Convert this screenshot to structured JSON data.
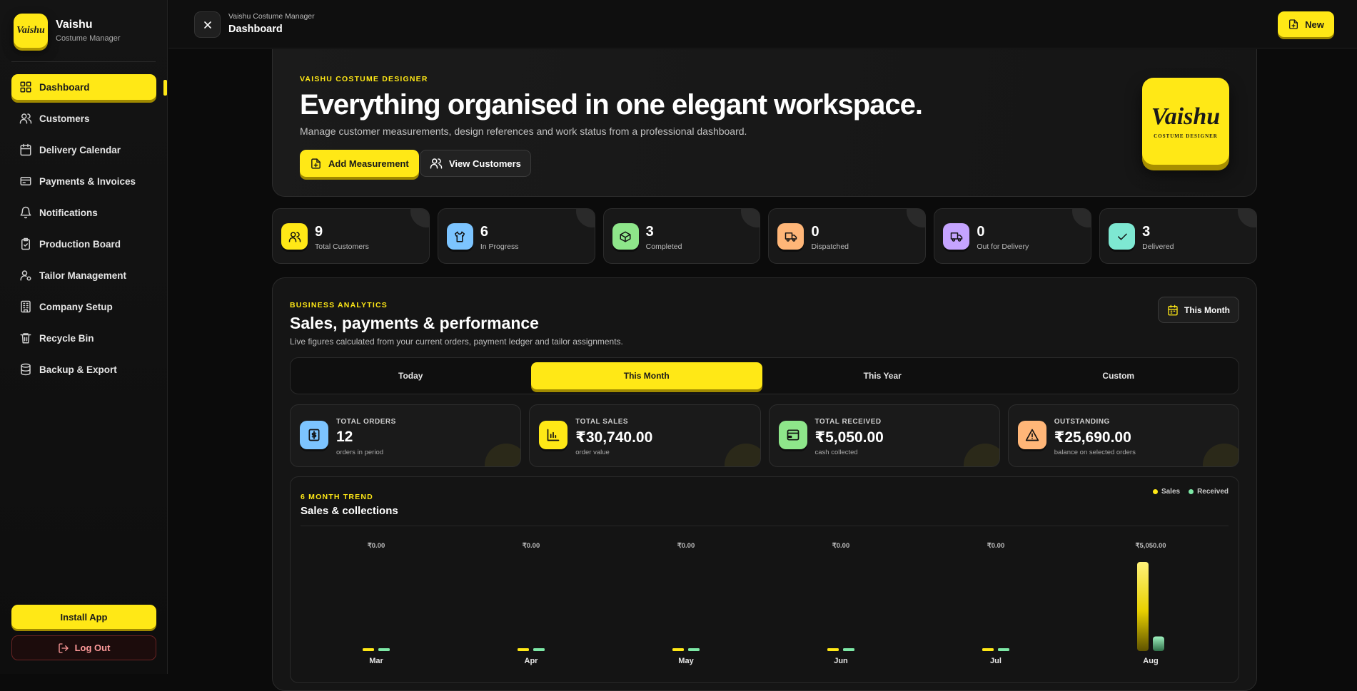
{
  "sidebar": {
    "brand_name": "Vaishu",
    "brand_sub": "Costume Manager",
    "logo_text": "Vaishu",
    "items": [
      {
        "label": "Dashboard",
        "icon": "dashboard-icon",
        "active": true
      },
      {
        "label": "Customers",
        "icon": "users-icon"
      },
      {
        "label": "Delivery Calendar",
        "icon": "calendar-icon"
      },
      {
        "label": "Payments & Invoices",
        "icon": "invoice-icon"
      },
      {
        "label": "Notifications",
        "icon": "bell-icon"
      },
      {
        "label": "Production Board",
        "icon": "clipboard-icon"
      },
      {
        "label": "Tailor Management",
        "icon": "user-gear-icon"
      },
      {
        "label": "Company Setup",
        "icon": "building-icon"
      },
      {
        "label": "Recycle Bin",
        "icon": "trash-icon"
      },
      {
        "label": "Backup & Export",
        "icon": "database-icon"
      }
    ],
    "install_label": "Install App",
    "logout_label": "Log Out"
  },
  "topbar": {
    "crumb": "Vaishu Costume Manager",
    "title": "Dashboard",
    "new_label": "New"
  },
  "hero": {
    "eyebrow": "VAISHU COSTUME DESIGNER",
    "title": "Everything organised in one elegant workspace.",
    "subtitle": "Manage customer measurements, design references and work status from a professional dashboard.",
    "add_label": "Add Measurement",
    "view_label": "View Customers",
    "logo_main": "Vaishu",
    "logo_sub": "COSTUME DESIGNER"
  },
  "stats": [
    {
      "value": "9",
      "label": "Total Customers",
      "color": "#ffe816",
      "icon": "users-icon"
    },
    {
      "value": "6",
      "label": "In Progress",
      "color": "#7cc4ff",
      "icon": "shirt-icon"
    },
    {
      "value": "3",
      "label": "Completed",
      "color": "#8ee68a",
      "icon": "box-icon"
    },
    {
      "value": "0",
      "label": "Dispatched",
      "color": "#ffb678",
      "icon": "truck-icon"
    },
    {
      "value": "0",
      "label": "Out for Delivery",
      "color": "#c5a4ff",
      "icon": "truck-icon"
    },
    {
      "value": "3",
      "label": "Delivered",
      "color": "#7ee8d2",
      "icon": "check-icon"
    }
  ],
  "analytics": {
    "eyebrow": "BUSINESS ANALYTICS",
    "title": "Sales, payments & performance",
    "subtitle": "Live figures calculated from your current orders, payment ledger and tailor assignments.",
    "period_label": "This Month",
    "tabs": [
      {
        "label": "Today"
      },
      {
        "label": "This Month",
        "active": true
      },
      {
        "label": "This Year"
      },
      {
        "label": "Custom"
      }
    ],
    "kpis": [
      {
        "label": "TOTAL ORDERS",
        "value": "12",
        "note": "orders in period",
        "color": "#7cc4ff",
        "icon": "receipt-icon"
      },
      {
        "label": "TOTAL SALES",
        "value": "₹30,740.00",
        "note": "order value",
        "color": "#ffe816",
        "icon": "bar-chart-icon"
      },
      {
        "label": "TOTAL RECEIVED",
        "value": "₹5,050.00",
        "note": "cash collected",
        "color": "#8ee68a",
        "icon": "wallet-icon"
      },
      {
        "label": "OUTSTANDING",
        "value": "₹25,690.00",
        "note": "balance on selected orders",
        "color": "#ffb678",
        "icon": "alert-icon"
      }
    ],
    "trend": {
      "eyebrow": "6 MONTH TREND",
      "title": "Sales & collections",
      "legend_sales": "Sales",
      "legend_received": "Received",
      "sales_color": "#ffe816",
      "received_color": "#7de8a6"
    }
  },
  "chart_data": {
    "type": "bar",
    "categories": [
      "Mar",
      "Apr",
      "May",
      "Jun",
      "Jul",
      "Aug"
    ],
    "series": [
      {
        "name": "Sales",
        "values": [
          0,
          0,
          0,
          0,
          0,
          30740
        ]
      },
      {
        "name": "Received",
        "values": [
          0,
          0,
          0,
          0,
          0,
          5050
        ]
      }
    ],
    "top_labels": [
      "₹0.00",
      "₹0.00",
      "₹0.00",
      "₹0.00",
      "₹0.00",
      "₹5,050.00"
    ]
  }
}
